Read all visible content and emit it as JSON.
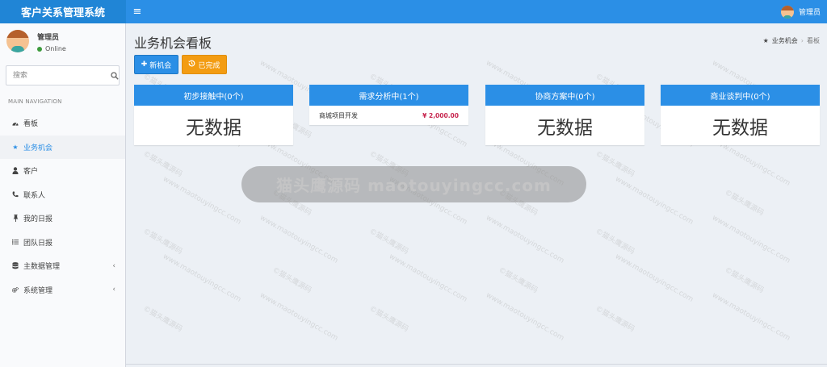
{
  "app": {
    "title": "客户关系管理系统"
  },
  "header": {
    "menu_toggle": "≡",
    "user_name": "管理员"
  },
  "sidebar": {
    "user": {
      "name": "管理员",
      "status": "Online"
    },
    "search": {
      "placeholder": "搜索"
    },
    "nav_header": "MAIN NAVIGATION",
    "items": [
      {
        "label": "看板",
        "icon": "dashboard-icon"
      },
      {
        "label": "业务机会",
        "icon": "star-icon",
        "active": true
      },
      {
        "label": "客户",
        "icon": "user-icon"
      },
      {
        "label": "联系人",
        "icon": "phone-icon"
      },
      {
        "label": "我的日报",
        "icon": "pin-icon"
      },
      {
        "label": "团队日报",
        "icon": "list-icon"
      },
      {
        "label": "主数据管理",
        "icon": "database-icon",
        "has_submenu": true
      },
      {
        "label": "系统管理",
        "icon": "cogs-icon",
        "has_submenu": true
      }
    ]
  },
  "page": {
    "title": "业务机会看板",
    "breadcrumb": {
      "parent": "业务机会",
      "current": "看板"
    },
    "buttons": {
      "new_label": "新机会",
      "done_label": "已完成"
    }
  },
  "board": {
    "columns": [
      {
        "title": "初步接触中(0个)",
        "empty_label": "无数据"
      },
      {
        "title": "需求分析中(1个)",
        "items": [
          {
            "name": "商城项目开发",
            "amount": "¥ 2,000.00"
          }
        ]
      },
      {
        "title": "协商方案中(0个)",
        "empty_label": "无数据"
      },
      {
        "title": "商业谈判中(0个)",
        "empty_label": "无数据"
      }
    ]
  },
  "watermark": {
    "banner": "猫头鹰源码 maotouyingcc.com",
    "tile_cn": "©猫头鹰源码",
    "tile_en": "www.maotouyingcc.com"
  },
  "colors": {
    "primary": "#2b8fe6",
    "logo_bg": "#2085d6",
    "warning": "#f39c12",
    "amount": "#c7254e",
    "online": "#3c9a3c"
  }
}
